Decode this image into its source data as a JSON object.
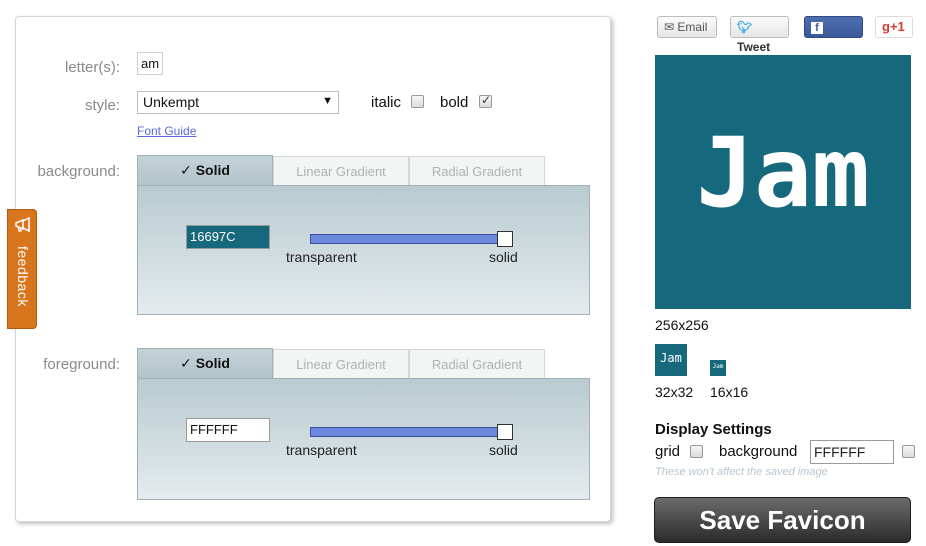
{
  "form": {
    "letters_label": "letter(s):",
    "letters_value": "am",
    "style_label": "style:",
    "style_value": "Unkempt",
    "italic_label": "italic",
    "italic_checked": false,
    "bold_label": "bold",
    "bold_checked": true,
    "font_guide": "Font Guide",
    "background_label": "background:",
    "foreground_label": "foreground:"
  },
  "background": {
    "tabs": [
      "✓ Solid",
      "Linear Gradient",
      "Radial Gradient"
    ],
    "hex": "16697C",
    "transparent_label": "transparent",
    "solid_label": "solid",
    "opacity": 1.0,
    "color": "#16697C"
  },
  "foreground": {
    "tabs": [
      "✓ Solid",
      "Linear Gradient",
      "Radial Gradient"
    ],
    "hex": "FFFFFF",
    "transparent_label": "transparent",
    "solid_label": "solid",
    "opacity": 1.0,
    "color": "#FFFFFF"
  },
  "feedback": {
    "label": "feedback",
    "icon": "megaphone-icon"
  },
  "share": {
    "email": "Email",
    "tweet": "Tweet",
    "share": "Share",
    "gplus": "g+1"
  },
  "preview": {
    "text": "Jam",
    "size_256": "256x256",
    "size_32": "32x32",
    "size_16": "16x16"
  },
  "display_settings": {
    "title": "Display Settings",
    "grid_label": "grid",
    "grid_checked": false,
    "background_label": "background",
    "background_value": "FFFFFF",
    "background_checked": false,
    "note": "These won't affect the saved image"
  },
  "save_button": "Save Favicon"
}
